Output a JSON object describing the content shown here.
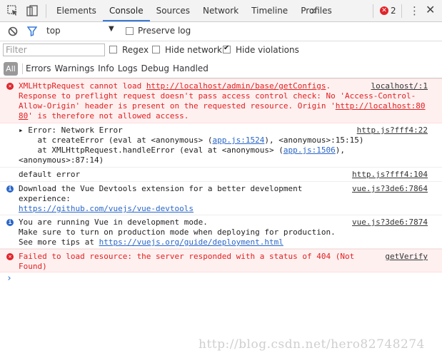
{
  "tabs": [
    "Elements",
    "Console",
    "Sources",
    "Network",
    "Timeline",
    "Profiles"
  ],
  "more_tabs": "»",
  "error_count": "2",
  "toolbar": {
    "context": "top",
    "preserve_log": "Preserve log"
  },
  "filter": {
    "placeholder": "Filter",
    "regex": "Regex",
    "hide_network": "Hide network",
    "hide_violations": "Hide violations",
    "hide_violations_checked": true
  },
  "levels": {
    "all": "All",
    "items": [
      "Errors",
      "Warnings",
      "Info",
      "Logs",
      "Debug",
      "Handled"
    ]
  },
  "messages": {
    "m1": {
      "l1a": "XMLHttpRequest cannot load ",
      "l1link": "http://localhost/admin/base/getConfigs",
      "l1b": ".",
      "l2": "Response to preflight request doesn't pass access control check: No 'Access-Control-",
      "l3a": "Allow-Origin' header is present on the requested resource. Origin '",
      "l3link": "http://localhost:80",
      "l4link": "80",
      "l4b": "' is therefore not allowed access.",
      "src": "localhost/:1"
    },
    "m2": {
      "l1": "▸ Error: Network Error",
      "l2a": "    at createError (eval at <anonymous> (",
      "l2link": "app.js:1524",
      "l2b": "), <anonymous>:15:15)",
      "l3a": "    at XMLHttpRequest.handleError (eval at <anonymous> (",
      "l3link": "app.js:1506",
      "l3b": "),",
      "l4": "<anonymous>:87:14)",
      "src": "http.js?fff4:22"
    },
    "m3": {
      "text": "default error",
      "src": "http.js?fff4:104"
    },
    "m4": {
      "l1": "Download the Vue Devtools extension for a better development",
      "l2": "experience:",
      "l3link": "https://github.com/vuejs/vue-devtools",
      "src": "vue.js?3de6:7864"
    },
    "m5": {
      "l1": "You are running Vue in development mode.",
      "l2": "Make sure to turn on production mode when deploying for production.",
      "l3a": "See more tips at ",
      "l3link": "https://vuejs.org/guide/deployment.html",
      "src": "vue.js?3de6:7874"
    },
    "m6": {
      "l1": "Failed to load resource: the server responded with a status of 404 (Not",
      "l2": "Found)",
      "src": "getVerify"
    }
  },
  "prompt": "›",
  "watermark": "http://blog.csdn.net/hero82748274"
}
